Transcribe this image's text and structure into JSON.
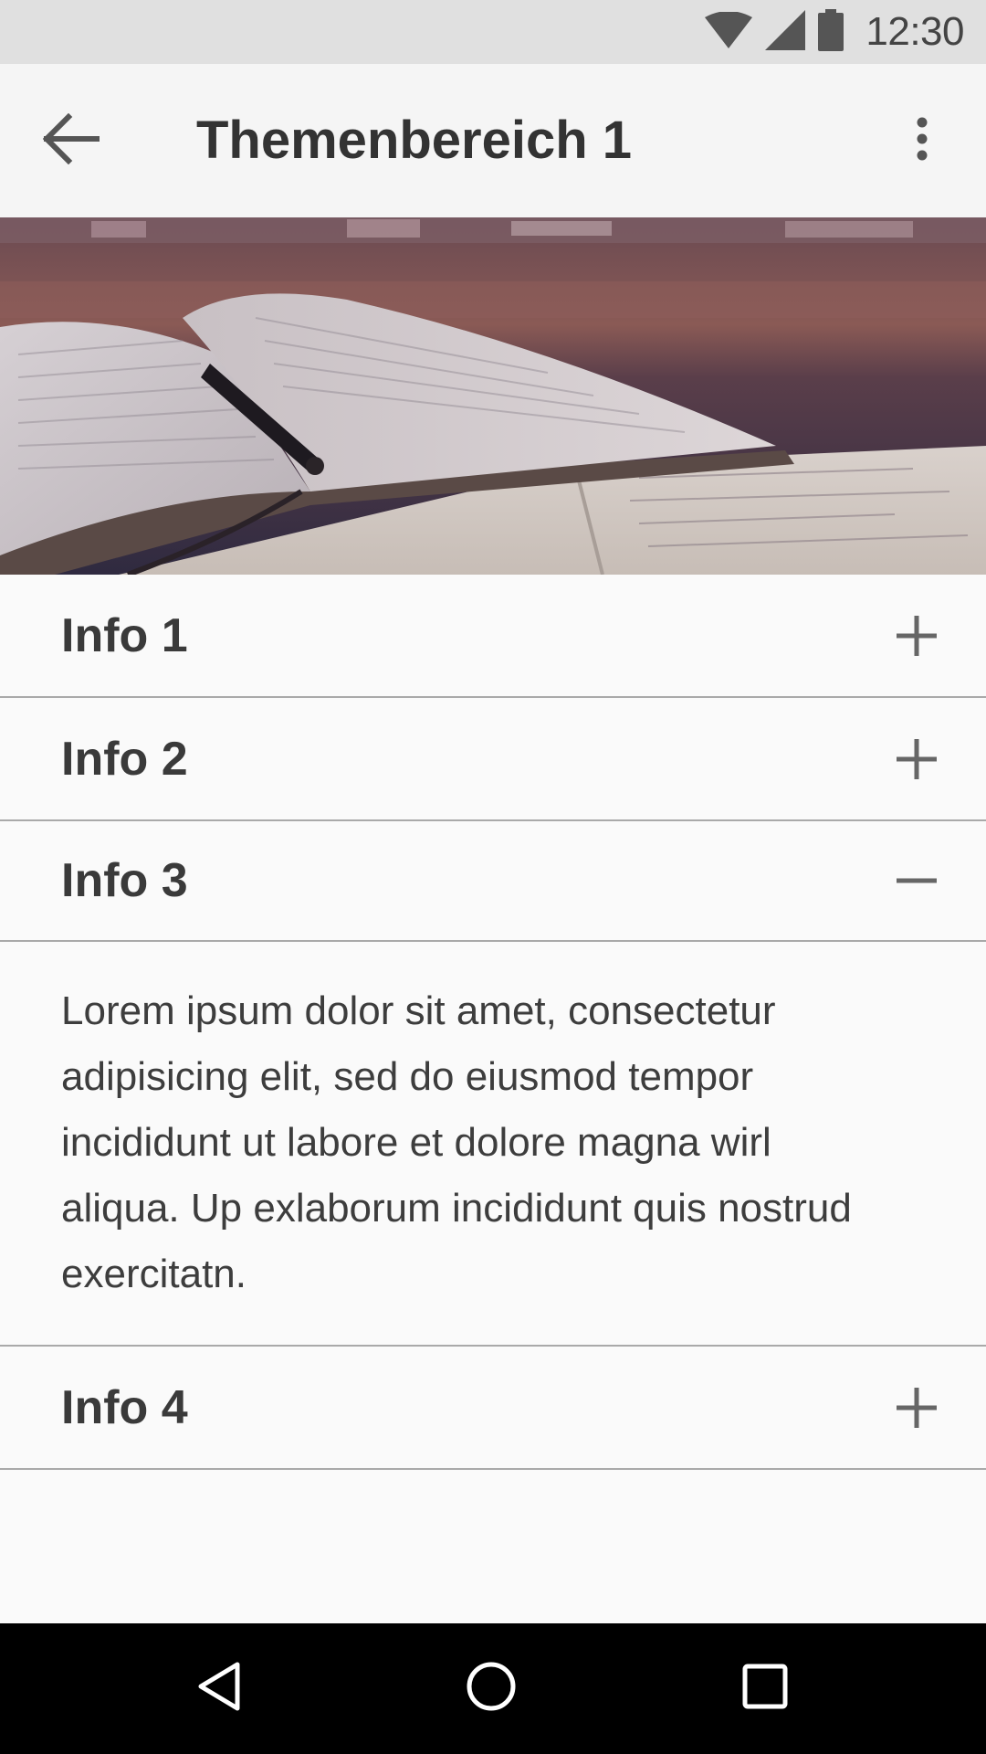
{
  "status_bar": {
    "time": "12:30",
    "icons": [
      "wifi-icon",
      "cell-signal-icon",
      "battery-icon"
    ]
  },
  "app_bar": {
    "title": "Themenbereich 1",
    "back_icon": "arrow-back-icon",
    "menu_icon": "more-vert-icon"
  },
  "hero": {
    "image": "open book with pen on desk"
  },
  "accordion": {
    "items": [
      {
        "label": "Info 1",
        "expanded": false,
        "toggle_icon": "plus-icon"
      },
      {
        "label": "Info 2",
        "expanded": false,
        "toggle_icon": "plus-icon"
      },
      {
        "label": "Info 3",
        "expanded": true,
        "toggle_icon": "minus-icon",
        "content": "Lorem ipsum dolor sit amet, consectetur adipisicing elit, sed do eiusmod tempor incididunt ut labore et dolore magna wirl aliqua. Up exlaborum incididunt quis nostrud exercitatn."
      },
      {
        "label": "Info 4",
        "expanded": false,
        "toggle_icon": "plus-icon"
      }
    ]
  },
  "nav_bar": {
    "icons": [
      "nav-back-icon",
      "nav-home-icon",
      "nav-recents-icon"
    ]
  },
  "colors": {
    "background": "#fafafa",
    "status_bar": "#e0e0e0",
    "app_bar": "#f5f5f5",
    "divider": "#a9a9a9",
    "text": "#3a3a3a",
    "nav_bar": "#000000"
  }
}
